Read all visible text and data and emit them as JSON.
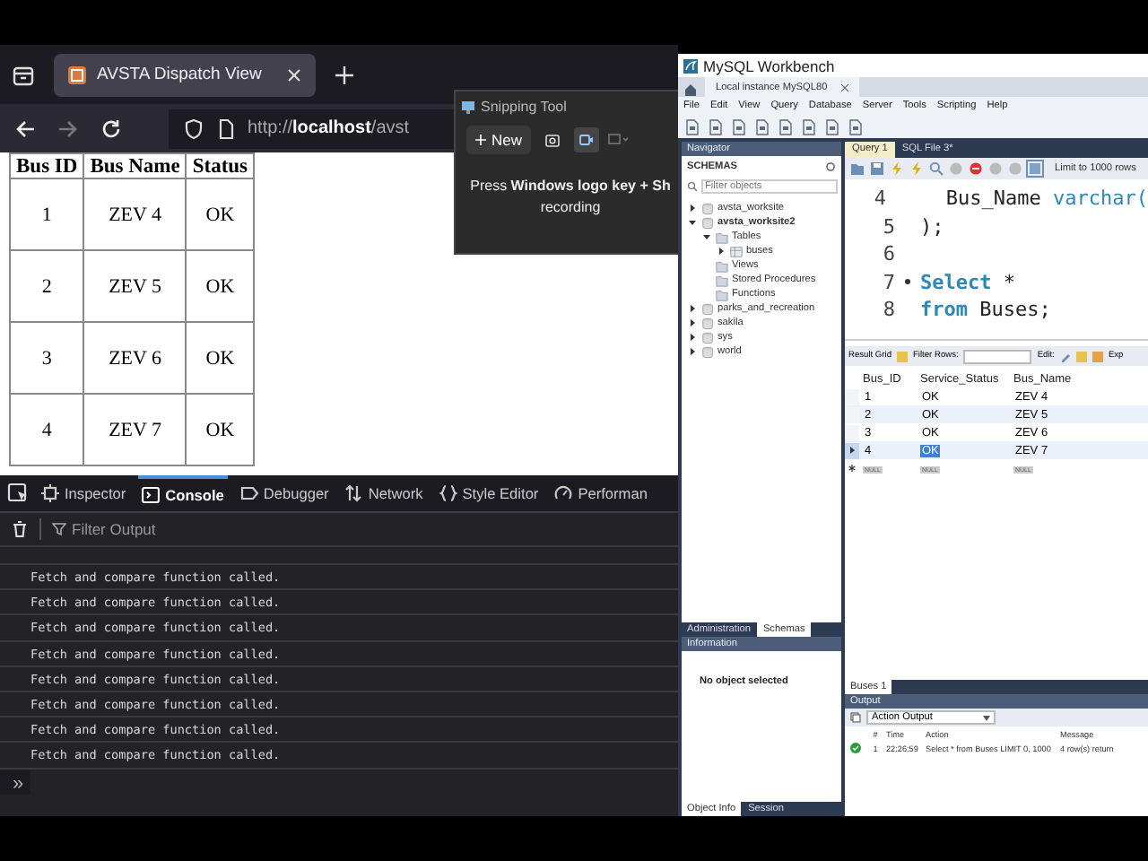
{
  "browser": {
    "tab": {
      "title": "AVSTA Dispatch View"
    },
    "url": "http://**localhost**/avst",
    "table": {
      "columns": [
        "Bus ID",
        "Bus Name",
        "Status"
      ],
      "rows": [
        [
          "1",
          "ZEV 4",
          "OK"
        ],
        [
          "2",
          "ZEV 5",
          "OK"
        ],
        [
          "3",
          "ZEV 6",
          "OK"
        ],
        [
          "4",
          "ZEV 7",
          "OK"
        ]
      ]
    },
    "devtools": {
      "tabs": [
        {
          "label": "Inspector",
          "kind": "inspector",
          "selected": false
        },
        {
          "label": "Console",
          "kind": "console",
          "selected": true
        },
        {
          "label": "Debugger",
          "kind": "debugger",
          "selected": false
        },
        {
          "label": "Network",
          "kind": "network",
          "selected": false
        },
        {
          "label": "Style Editor",
          "kind": "style",
          "selected": false
        },
        {
          "label": "Performan",
          "kind": "performance",
          "selected": false
        }
      ],
      "filter": {
        "placeholder": "Filter Output"
      },
      "log": [
        "Fetch and compare function called.",
        "Fetch and compare function called.",
        "Fetch and compare function called.",
        "Fetch and compare function called.",
        "Fetch and compare function called.",
        "Fetch and compare function called.",
        "Fetch and compare function called.",
        "Fetch and compare function called."
      ],
      "prompt": "»"
    }
  },
  "snipping_tool": {
    "title": "Snipping Tool",
    "new_button": "New",
    "modes": [
      {
        "kind": "screenshot",
        "selected": false
      },
      {
        "kind": "video",
        "selected": true
      }
    ],
    "message": [
      "Press **Windows logo key + Sh**",
      "recording"
    ]
  },
  "workbench": {
    "title": "MySQL Workbench",
    "connection_tab": "Local instance MySQL80",
    "menu": [
      "File",
      "Edit",
      "View",
      "Query",
      "Database",
      "Server",
      "Tools",
      "Scripting",
      "Help"
    ],
    "navigator": {
      "title": "Navigator",
      "header": "SCHEMAS",
      "filter": {
        "placeholder": "Filter objects"
      },
      "schemas": [
        {
          "name": "avsta_worksite",
          "kind": "schema",
          "default": false,
          "expanded": false
        },
        {
          "name": "avsta_worksite2",
          "kind": "schema",
          "default": true,
          "expanded": true,
          "children": [
            {
              "name": "Tables",
              "kind": "folder",
              "expanded": true,
              "children": [
                {
                  "name": "buses",
                  "kind": "table",
                  "expanded": false
                }
              ]
            },
            {
              "name": "Views",
              "kind": "folder"
            },
            {
              "name": "Stored Procedures",
              "kind": "folder"
            },
            {
              "name": "Functions",
              "kind": "folder"
            }
          ]
        },
        {
          "name": "parks_and_recreation",
          "kind": "schema",
          "default": false,
          "expanded": false
        },
        {
          "name": "sakila",
          "kind": "schema",
          "default": false,
          "expanded": false
        },
        {
          "name": "sys",
          "kind": "schema",
          "default": false,
          "expanded": false
        },
        {
          "name": "world",
          "kind": "schema",
          "default": false,
          "expanded": false
        }
      ],
      "tabs": [
        {
          "label": "Administration",
          "selected": false
        },
        {
          "label": "Schemas",
          "selected": true
        }
      ],
      "info_title": "Information",
      "info_text": "No object selected",
      "bottom_tabs": [
        {
          "label": "Object Info",
          "selected": true
        },
        {
          "label": "Session",
          "selected": false
        }
      ]
    },
    "query_tabs": [
      {
        "label": "Query 1",
        "selected": true
      },
      {
        "label": "SQL File 3*",
        "selected": false
      }
    ],
    "limit": "Limit to 1000 rows",
    "code": [
      {
        "number": "4",
        "indented": true,
        "marker": false,
        "tokens": [
          {
            "text": "Bus_Name ",
            "kind": "plain"
          },
          {
            "text": "varchar(",
            "kind": "type"
          }
        ]
      },
      {
        "number": "5",
        "indented": false,
        "marker": false,
        "tokens": [
          {
            "text": ");",
            "kind": "plain"
          }
        ]
      },
      {
        "number": "6",
        "marker": false
      },
      {
        "number": "7",
        "indented": false,
        "marker": true,
        "tokens": [
          {
            "text": "Select",
            "kind": "keyword"
          },
          {
            "text": " *",
            "kind": "plain"
          }
        ]
      },
      {
        "number": "8",
        "indented": false,
        "marker": false,
        "tokens": [
          {
            "text": "from",
            "kind": "keyword"
          },
          {
            "text": " Buses;",
            "kind": "plain"
          }
        ]
      }
    ],
    "results": {
      "toolbar": [
        "Result Grid",
        "Filter Rows:",
        "Edit:",
        "Exp"
      ],
      "columns": [
        "Bus_ID",
        "Service_Status",
        "Bus_Name"
      ],
      "rows": [
        {
          "selected": false,
          "cells": [
            {
              "text": "1",
              "selected": false
            },
            {
              "text": "OK",
              "selected": false
            },
            {
              "text": "ZEV 4",
              "selected": false
            }
          ]
        },
        {
          "selected": false,
          "cells": [
            {
              "text": "2",
              "selected": false
            },
            {
              "text": "OK",
              "selected": false
            },
            {
              "text": "ZEV 5",
              "selected": false
            }
          ]
        },
        {
          "selected": false,
          "cells": [
            {
              "text": "3",
              "selected": false
            },
            {
              "text": "OK",
              "selected": false
            },
            {
              "text": "ZEV 6",
              "selected": false
            }
          ]
        },
        {
          "selected": true,
          "cells": [
            {
              "text": "4",
              "selected": false
            },
            {
              "text": "OK",
              "selected": true
            },
            {
              "text": "ZEV 7",
              "selected": false
            }
          ]
        }
      ],
      "new_row": [
        "NULL",
        "NULL",
        "NULL"
      ]
    },
    "result_tab": "Buses 1",
    "output": {
      "title": "Output",
      "mode": "Action Output",
      "columns": [
        "#",
        "Time",
        "Action",
        "Message"
      ],
      "rows": [
        {
          "kind": "success",
          "cells": [
            "1",
            "22:26:59",
            "Select * from Buses LIMIT 0, 1000",
            "4 row(s) return"
          ]
        }
      ]
    }
  }
}
